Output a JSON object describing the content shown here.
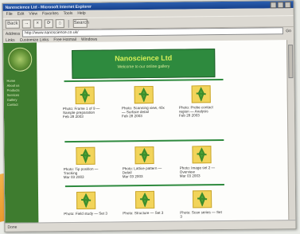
{
  "window": {
    "title": "Nanoscience Ltd - Microsoft Internet Explorer"
  },
  "menu": [
    "File",
    "Edit",
    "View",
    "Favorites",
    "Tools",
    "Help"
  ],
  "toolbar": {
    "back": "Back",
    "forward": "→",
    "stop": "×",
    "refresh": "⟳",
    "home": "⌂",
    "search": "Search"
  },
  "address": {
    "label": "Address",
    "value": "http://www.nanoscience.co.uk/",
    "go": "Go"
  },
  "links": {
    "label": "Links",
    "items": [
      "Customize Links",
      "Free Hotmail",
      "Windows"
    ]
  },
  "sidebar": {
    "links": [
      "Home",
      "About us",
      "Products",
      "Services",
      "Gallery",
      "Contact"
    ]
  },
  "banner": {
    "title": "Nanoscience Ltd",
    "subtitle": "Welcome to our online gallery"
  },
  "cards": [
    {
      "caption": "Photo: Frame 1 of 9 — Sample preparation",
      "date": "Feb 28 2003"
    },
    {
      "caption": "Photo: Scanning view, 40x — Surface detail",
      "date": "Feb 28 2003"
    },
    {
      "caption": "Photo: Probe contact region — Analysis",
      "date": "Feb 28 2003"
    },
    {
      "caption": "Photo: Tip position — Tracking",
      "date": "Mar 03 2003"
    },
    {
      "caption": "Photo: Lattice pattern — Detail",
      "date": "Mar 03 2003"
    },
    {
      "caption": "Photo: Image set 2 — Overview",
      "date": "Mar 03 2003"
    },
    {
      "caption": "Photo: Field study — Set 3",
      "date": ""
    },
    {
      "caption": "Photo: Structure — Set 3",
      "date": ""
    },
    {
      "caption": "Photo: Scan series — Set 3",
      "date": ""
    }
  ],
  "status": {
    "text": "Done"
  },
  "colors": {
    "banner": "#2e8a3e",
    "sidebar": "#3e7c2f",
    "thumbnail": "#f2d45a"
  }
}
